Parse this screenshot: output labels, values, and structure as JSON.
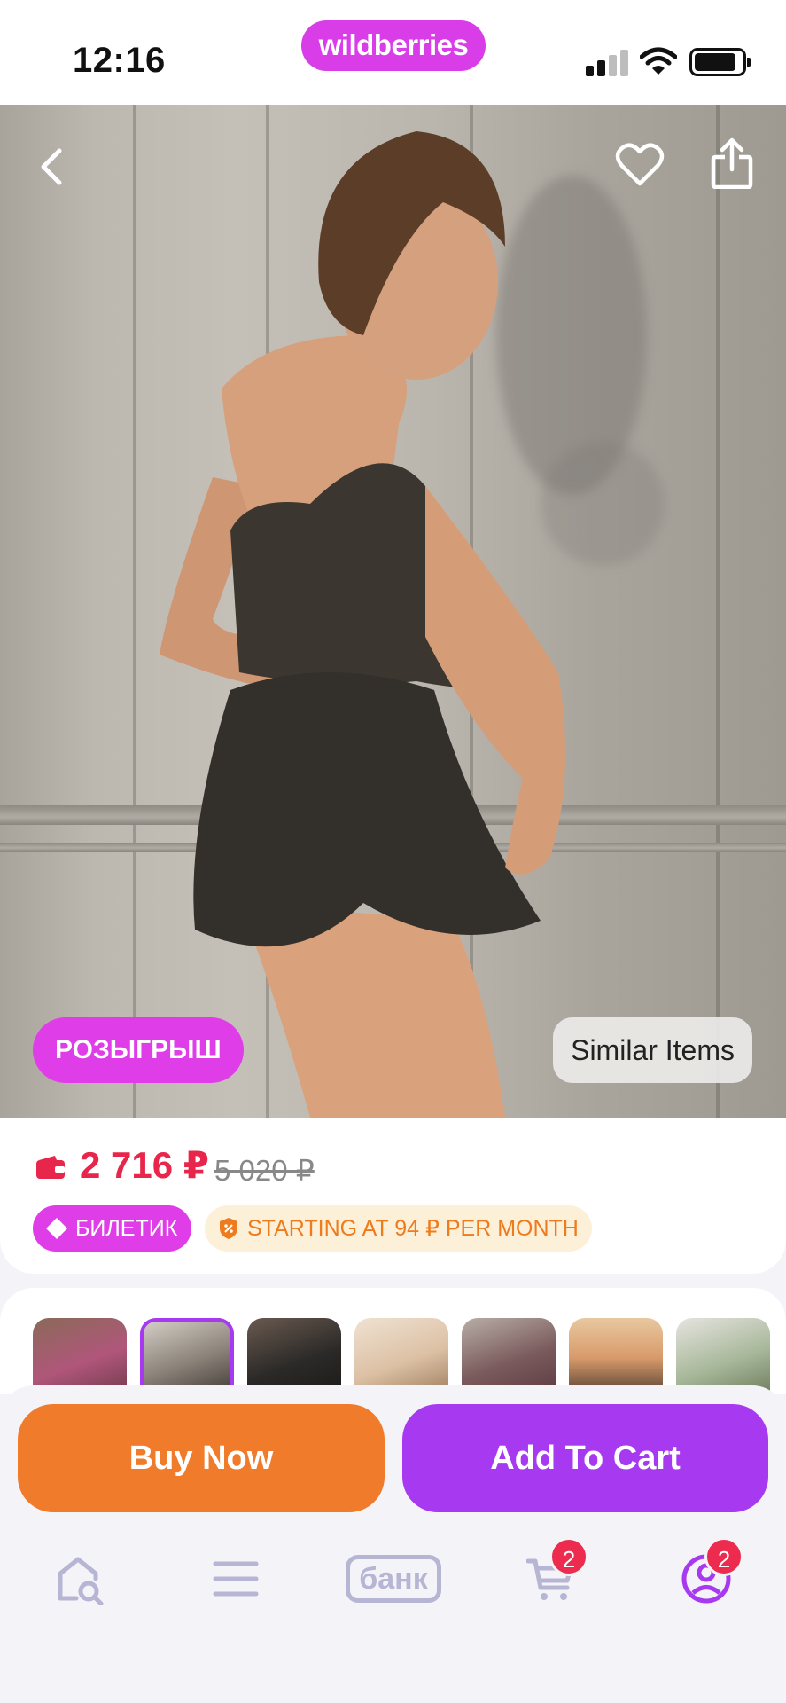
{
  "status_bar": {
    "time": "12:16",
    "brand": "wildberries",
    "icons": [
      "signal-icon",
      "wifi-icon",
      "battery-icon"
    ]
  },
  "product_image": {
    "nav": {
      "back_icon": "chevron-left-icon",
      "favorite_icon": "heart-outline-icon",
      "share_icon": "share-icon"
    },
    "badge_left": "РОЗЫГРЫШ",
    "badge_right": "Similar Items"
  },
  "price_card": {
    "wallet_icon": "wallet-icon",
    "price": "2 716 ₽",
    "old_price": "5 020 ₽",
    "ticket_badge": "БИЛЕТИК",
    "installment_badge": "STARTING AT 94 ₽ PER MONTH"
  },
  "thumbnails": {
    "count": 7,
    "active_index": 1
  },
  "actions": {
    "buy_now": "Buy Now",
    "add_to_cart": "Add To Cart"
  },
  "tabbar": {
    "items": [
      {
        "icon": "home-search-icon"
      },
      {
        "icon": "menu-icon"
      },
      {
        "icon": "bank-icon",
        "label": "банк"
      },
      {
        "icon": "cart-icon",
        "badge": "2"
      },
      {
        "icon": "profile-icon",
        "badge": "2"
      }
    ]
  },
  "colors": {
    "brand": "#d93de8",
    "accent_purple": "#a73af0",
    "orange": "#f07b2a",
    "price_red": "#e8254a",
    "badge_red": "#ec2b4e"
  }
}
